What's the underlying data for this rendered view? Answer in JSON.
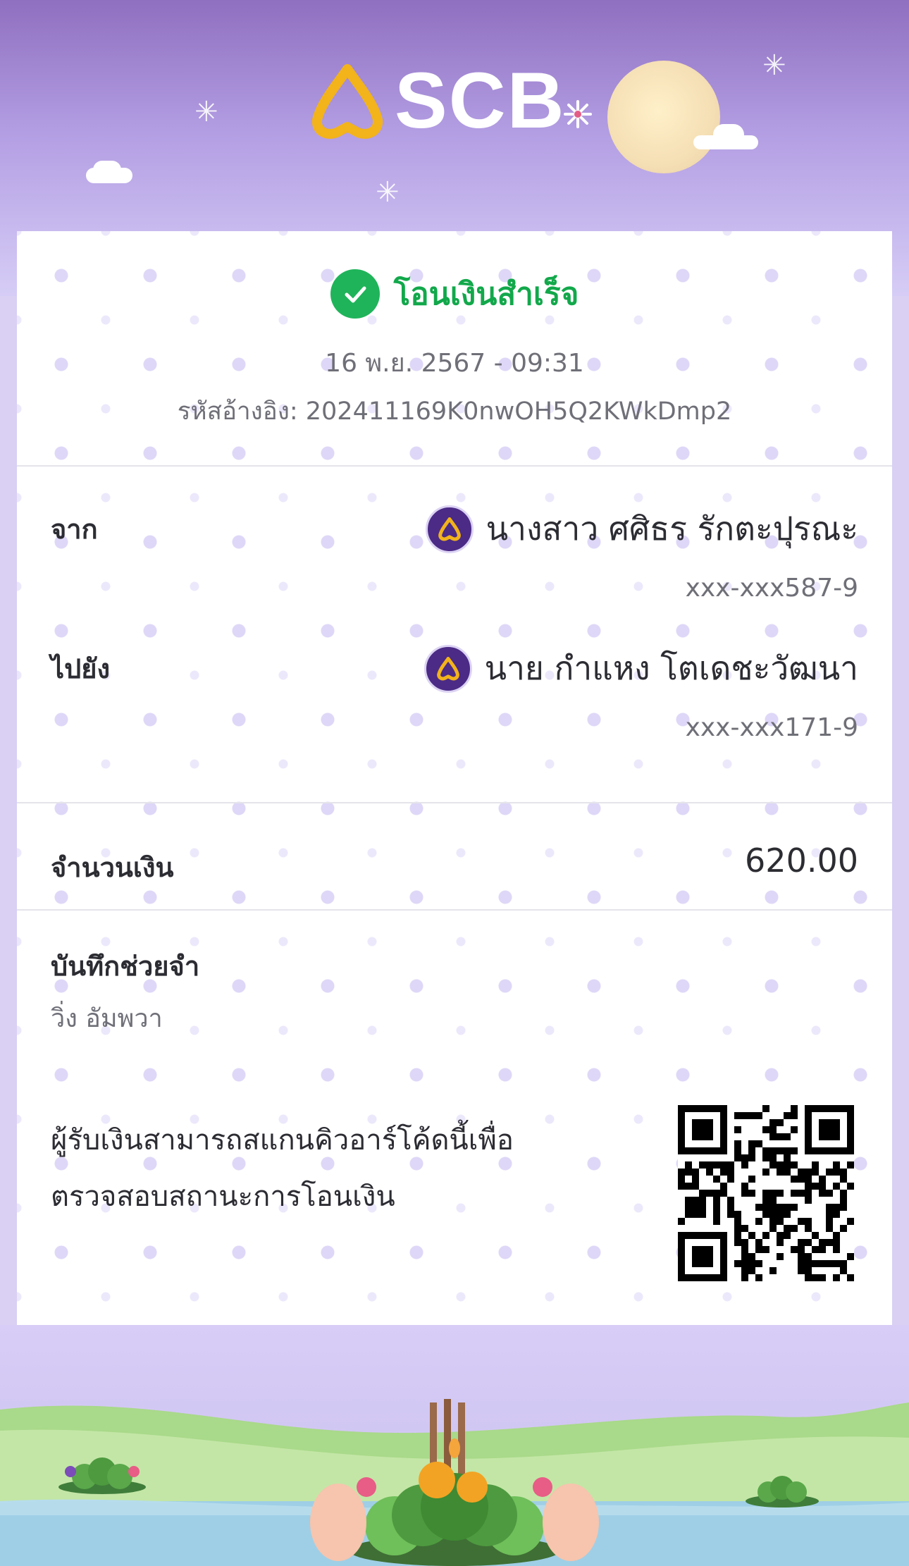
{
  "header": {
    "brand": "SCB"
  },
  "receipt": {
    "status_title": "โอนเงินสำเร็จ",
    "datetime": "16 พ.ย. 2567 - 09:31",
    "reference": "รหัสอ้างอิง: 202411169K0nwOH5Q2KWkDmp2",
    "from_label": "จาก",
    "from_name": "นางสาว ศศิธร รักตะปุรณะ",
    "from_account": "xxx-xxx587-9",
    "to_label": "ไปยัง",
    "to_name": "นาย กำแหง โตเดชะวัฒนา",
    "to_account": "xxx-xxx171-9",
    "amount_label": "จำนวนเงิน",
    "amount": "620.00",
    "memo_label": "บันทึกช่วยจำ",
    "memo_value": "วิ่ง อัมพวา",
    "qr_text_line1": "ผู้รับเงินสามารถสแกนคิวอาร์โค้ดนี้เพื่อ",
    "qr_text_line2": "ตรวจสอบสถานะการโอนเงิน"
  },
  "colors": {
    "success": "#12a84b",
    "brand_purple": "#4b2b86",
    "brand_gold": "#f2b31b"
  },
  "icons": {
    "status": "check-circle-icon",
    "bank": "scb-bank-icon",
    "qr": "qr-code-icon"
  }
}
